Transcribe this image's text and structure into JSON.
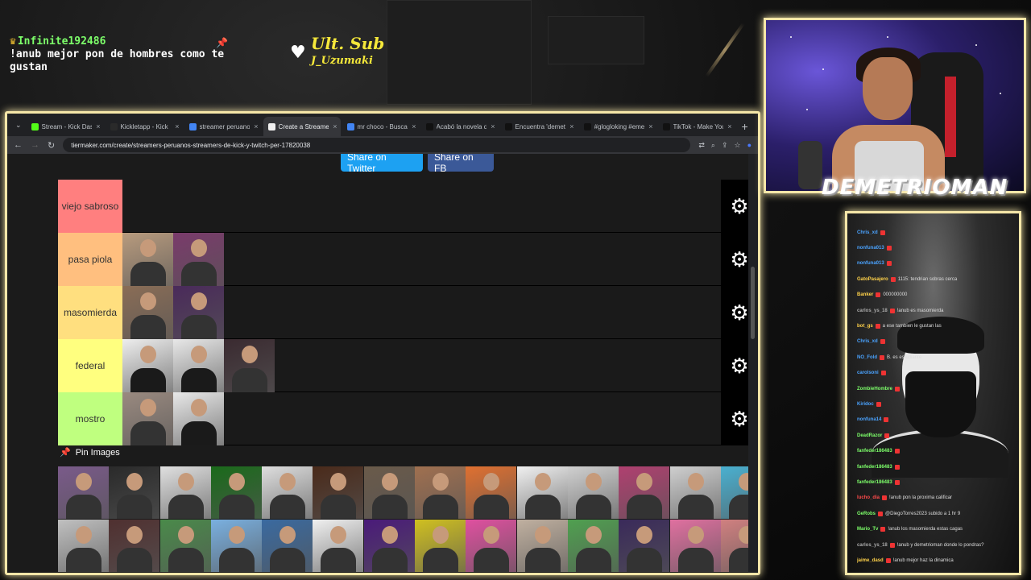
{
  "overlay": {
    "chat_user": "Infinite192486",
    "chat_message": "!anub mejor pon de hombres como te gustan",
    "ult_sub_title": "Ult. Sub",
    "ult_sub_name": "J_Uzumaki",
    "streamer_name": "DEMETRIOMAN"
  },
  "browser": {
    "tabs": [
      {
        "label": "Stream - Kick Dashbo",
        "color": "#53fc18"
      },
      {
        "label": "Kickletapp - Kick",
        "color": "#2a2a2a"
      },
      {
        "label": "streamer peruano g",
        "color": "#4285f4"
      },
      {
        "label": "Create a Streamers P",
        "color": "#f0f0f0",
        "active": true
      },
      {
        "label": "mr choco - Buscar co",
        "color": "#4285f4"
      },
      {
        "label": "Acabó la novela de C",
        "color": "#111111"
      },
      {
        "label": "Encuentra 'demetrio",
        "color": "#111111"
      },
      {
        "label": "#glogloking #emetri",
        "color": "#111111"
      },
      {
        "label": "TikTok - Make Your D",
        "color": "#111111"
      }
    ],
    "new_tab": "+",
    "url": "tiermaker.com/create/streamers-peruanos-streamers-de-kick-y-twitch-per-17820038"
  },
  "page": {
    "share_twitter": "Share on Twitter",
    "share_fb": "Share on FB",
    "pin_images": "Pin Images",
    "tiers": [
      {
        "label": "viejo sabroso",
        "color": "#ff7f7f",
        "items": []
      },
      {
        "label": "pasa piola",
        "color": "#ffbf7f",
        "items": [
          "#b89b7e",
          "#7a3b6b"
        ]
      },
      {
        "label": "masomierda",
        "color": "#ffdf7f",
        "items": [
          "#8a6d56",
          "#4a2a5a"
        ]
      },
      {
        "label": "federal",
        "color": "#ffff7f",
        "items": [
          "#eeeeee",
          "#e8e8e8",
          "#3a2a30"
        ]
      },
      {
        "label": "mostro",
        "color": "#bfff7f",
        "items": [
          "#9a8a80",
          "#e8e8e8"
        ]
      }
    ],
    "pool": [
      "#7a5a8a",
      "#2a2a2a",
      "#e0e0e0",
      "#1a6a1a",
      "#dedede",
      "#4a2a1a",
      "#6a5a4a",
      "#a07050",
      "#e07030",
      "#f0f0f0",
      "#d0d0d0",
      "#b04070",
      "#cfcfcf",
      "#4ab0d0",
      "#c0c0c0",
      "#503030",
      "#4a8a4a",
      "#7ab0e0",
      "#3a6aa0",
      "#f0f0f0",
      "#4a1a7a",
      "#d0c020",
      "#e050a0",
      "#c0b0a0",
      "#50a050",
      "#3a2a5a",
      "#e070a0",
      "#d08080"
    ]
  },
  "chat_lines": [
    {
      "user": "Chris_xd",
      "color": "#4aa3ff",
      "text": ""
    },
    {
      "user": "nonfuna013",
      "color": "#4aa3ff",
      "text": ""
    },
    {
      "user": "nonfuna013",
      "color": "#4aa3ff",
      "text": ""
    },
    {
      "user": "GatoPasajero",
      "color": "#ffd24a",
      "text": "1115: tendrian sobras cerca"
    },
    {
      "user": "Banker",
      "color": "#ffd24a",
      "text": "000000000"
    },
    {
      "user": "carlos_ys_18",
      "color": "#aaaaaa",
      "text": "!anub es masomierda"
    },
    {
      "user": "bot_gs",
      "color": "#ffd24a",
      "text": "a ese tambien le gustan las"
    },
    {
      "user": "Chris_xd",
      "color": "#4aa3ff",
      "text": ""
    },
    {
      "user": "NO_Fold",
      "color": "#4aa3ff",
      "text": "B. es estudiante"
    },
    {
      "user": "carolsoni",
      "color": "#4aa3ff",
      "text": ""
    },
    {
      "user": "ZombieHombre",
      "color": "#7dff6a",
      "text": ""
    },
    {
      "user": "Kiridoc",
      "color": "#4aa3ff",
      "text": ""
    },
    {
      "user": "nonfuna14",
      "color": "#4aa3ff",
      "text": ""
    },
    {
      "user": "DeadRazor",
      "color": "#7dff6a",
      "text": ""
    },
    {
      "user": "fanfeder186483",
      "color": "#7dff6a",
      "text": ""
    },
    {
      "user": "fanfeder186483",
      "color": "#7dff6a",
      "text": ""
    },
    {
      "user": "fanfeder186483",
      "color": "#7dff6a",
      "text": ""
    },
    {
      "user": "lucho_dia",
      "color": "#ff4a4a",
      "text": "!anub pon la proxima calificar"
    },
    {
      "user": "GeRobs",
      "color": "#7dff6a",
      "text": "@DiegoTorres2023 subido a 1 hr 9"
    },
    {
      "user": "Mario_Tv",
      "color": "#7dff6a",
      "text": "!anub los masomierda estas cagas"
    },
    {
      "user": "carlos_ys_18",
      "color": "#aaaaaa",
      "text": "!anub y demetrioman donde lo pondras?"
    },
    {
      "user": "jaime_dasd",
      "color": "#ffd24a",
      "text": "!anub mejor haz la dinamica"
    }
  ],
  "colors": {
    "frame_glow": "#f5e6a8",
    "tiermaker_bg": "#1b1b1b"
  }
}
